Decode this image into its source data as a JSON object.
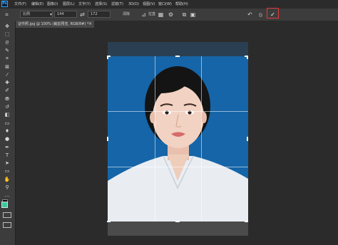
{
  "app": {
    "logo_text": "Ps"
  },
  "menu": [
    "文件(F)",
    "编辑(E)",
    "图像(I)",
    "图层(L)",
    "文字(Y)",
    "选择(S)",
    "滤镜(T)",
    "3D(D)",
    "视图(V)",
    "窗口(W)",
    "帮助(H)"
  ],
  "options": {
    "ratio_value": "比例",
    "width_value": "144",
    "height_value": "172",
    "clear_label": "清除",
    "straighten_label": "拉直"
  },
  "document": {
    "tab_label": "证件照.jpg @ 100% (裁剪预览, RGB/8#) *",
    "close": "×"
  },
  "colors": {
    "accent_red": "#e23a3a",
    "photo_blue": "#1565a8",
    "panel": "#3c3c3c",
    "canvas_bg": "#2b2b2b"
  },
  "icons": {
    "commit": "✓",
    "cancel": "⦸",
    "reset": "↶",
    "swap": "⇄",
    "overlay": "▦",
    "gear": "⚙",
    "delete_cropped": "⧉",
    "content_aware": "▣"
  },
  "tools": [
    {
      "name": "move-tool-icon",
      "glyph": "✥"
    },
    {
      "name": "marquee-tool-icon",
      "glyph": "⬚"
    },
    {
      "name": "lasso-tool-icon",
      "glyph": "ᘓ"
    },
    {
      "name": "quick-select-tool-icon",
      "glyph": "✎"
    },
    {
      "name": "crop-tool-icon",
      "glyph": "⌗"
    },
    {
      "name": "frame-tool-icon",
      "glyph": "⊠"
    },
    {
      "name": "eyedropper-tool-icon",
      "glyph": "⁄"
    },
    {
      "name": "healing-brush-tool-icon",
      "glyph": "✚"
    },
    {
      "name": "brush-tool-icon",
      "glyph": "✐"
    },
    {
      "name": "clone-stamp-tool-icon",
      "glyph": "⛃"
    },
    {
      "name": "history-brush-tool-icon",
      "glyph": "↺"
    },
    {
      "name": "eraser-tool-icon",
      "glyph": "◧"
    },
    {
      "name": "gradient-tool-icon",
      "glyph": "▭"
    },
    {
      "name": "blur-tool-icon",
      "glyph": "♦"
    },
    {
      "name": "dodge-tool-icon",
      "glyph": "●"
    },
    {
      "name": "pen-tool-icon",
      "glyph": "✒"
    },
    {
      "name": "type-tool-icon",
      "glyph": "T"
    },
    {
      "name": "path-select-tool-icon",
      "glyph": "➤"
    },
    {
      "name": "shape-tool-icon",
      "glyph": "▭"
    },
    {
      "name": "hand-tool-icon",
      "glyph": "✋"
    },
    {
      "name": "zoom-tool-icon",
      "glyph": "⚲"
    },
    {
      "name": "more-tools-icon",
      "glyph": "…"
    }
  ]
}
